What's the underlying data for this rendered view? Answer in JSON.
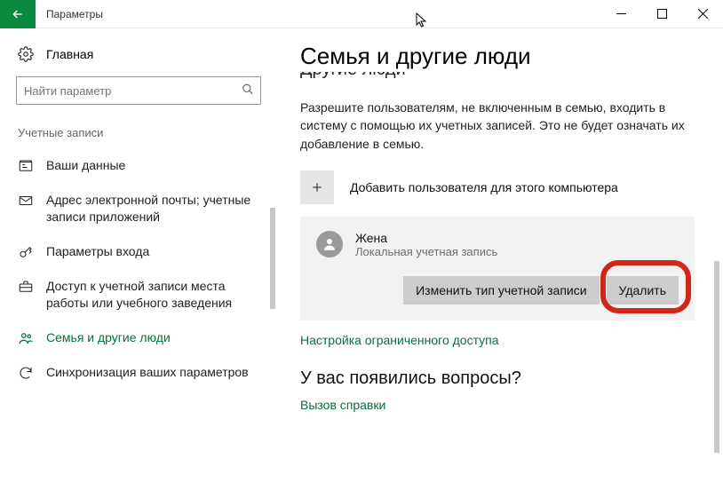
{
  "titlebar": {
    "app_title": "Параметры"
  },
  "sidebar": {
    "home": "Главная",
    "search_placeholder": "Найти параметр",
    "group_title": "Учетные записи",
    "items": [
      {
        "label": "Ваши данные"
      },
      {
        "label": "Адрес электронной почты; учетные записи приложений"
      },
      {
        "label": "Параметры входа"
      },
      {
        "label": "Доступ к учетной записи места работы или учебного заведения"
      },
      {
        "label": "Семья и другие люди"
      },
      {
        "label": "Синхронизация ваших параметров"
      }
    ]
  },
  "main": {
    "heading": "Семья и другие люди",
    "cut_subheading": "Другие люди",
    "description": "Разрешите пользователям, не включенным в семью, входить в систему с помощью их учетных записей. Это не будет означать их добавление в семью.",
    "add_label": "Добавить пользователя для этого компьютера",
    "user": {
      "name": "Жена",
      "subline": "Локальная учетная запись",
      "change_label": "Изменить тип учетной записи",
      "remove_label": "Удалить"
    },
    "restricted_link": "Настройка ограниченного доступа",
    "questions_heading": "У вас появились вопросы?",
    "help_link": "Вызов справки"
  }
}
